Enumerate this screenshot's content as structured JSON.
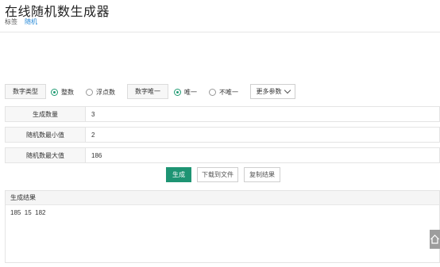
{
  "header": {
    "title": "在线随机数生成器",
    "tag_label": "标签",
    "tag_link": "随机"
  },
  "options": {
    "number_type_label": "数字类型",
    "integer_label": "整数",
    "float_label": "浮点数",
    "number_type_selected": "整数",
    "unique_label": "数字唯一",
    "unique_yes_label": "唯一",
    "unique_no_label": "不唯一",
    "unique_selected": "唯一",
    "more_params_label": "更多参数"
  },
  "fields": {
    "count_label": "生成数量",
    "count_value": "3",
    "min_label": "随机数最小值",
    "min_value": "2",
    "max_label": "随机数最大值",
    "max_value": "186"
  },
  "actions": {
    "generate_label": "生成",
    "download_label": "下载到文件",
    "copy_label": "复制结果"
  },
  "result": {
    "title": "生成结果",
    "text": "185  15  182"
  },
  "colors": {
    "accent": "#1e9473",
    "link": "#2a8bd8"
  },
  "icons": {
    "more_params": "chevron-down-icon",
    "floating": "home-icon"
  }
}
